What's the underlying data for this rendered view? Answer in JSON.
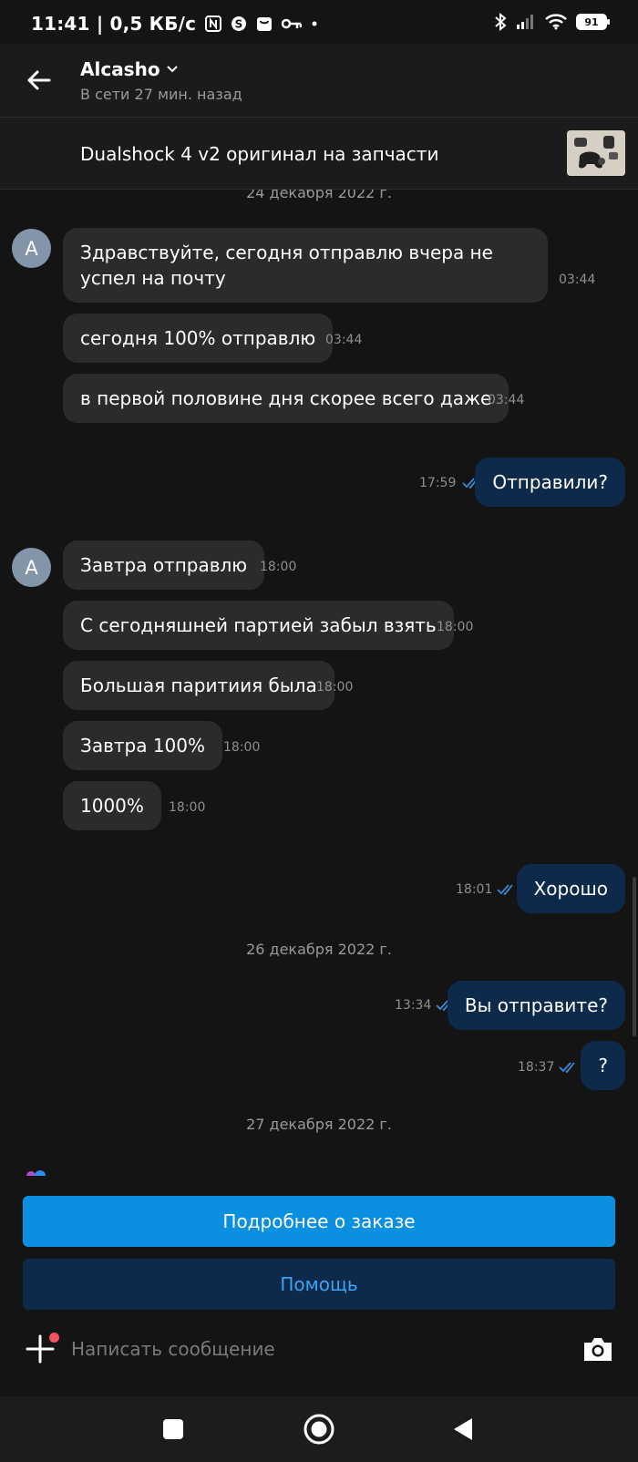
{
  "status_bar": {
    "text": "11:41 | 0,5 КБ/с",
    "battery": "91",
    "left_icons": [
      "nfc-icon",
      "skype-icon",
      "shopping-bag-icon",
      "key-icon",
      "dot-icon"
    ],
    "right_icons": [
      "bluetooth-icon",
      "signal-icon",
      "wifi-icon",
      "battery-icon"
    ]
  },
  "header": {
    "name": "Alcasho",
    "status": "В сети 27 мин. назад",
    "back_icon": "arrow-left-icon",
    "dropdown_icon": "chevron-down-icon"
  },
  "product": {
    "title": "Dualshock 4 v2 оригинал на запчасти",
    "thumbnail_icon": "product-thumbnail"
  },
  "messages": {
    "date1": "24 декабря 2022 г.",
    "date2": "26 декабря 2022 г.",
    "date3": "27 декабря 2022 г.",
    "avatar_letter": "A",
    "m1": {
      "text": "Здравствуйте, сегодня отправлю вчера не успел на почту",
      "time": "03:44"
    },
    "m2": {
      "text": "сегодня 100% отправлю",
      "time": "03:44"
    },
    "m3": {
      "text": "в первой половине дня скорее всего даже",
      "time": "03:44"
    },
    "m4": {
      "text": "Отправили?",
      "time": "17:59"
    },
    "m5": {
      "text": "Завтра отправлю",
      "time": "18:00"
    },
    "m6": {
      "text": "С сегодняшней партией забыл взять",
      "time": "18:00"
    },
    "m7": {
      "text": "Большая паритиия была",
      "time": "18:00"
    },
    "m8": {
      "text": "Завтра 100%",
      "time": "18:00"
    },
    "m9": {
      "text": "1000%",
      "time": "18:00"
    },
    "m10": {
      "text": "Хорошо",
      "time": "18:01"
    },
    "m11": {
      "text": "Вы отправите?",
      "time": "13:34"
    },
    "m12": {
      "text": "?",
      "time": "18:37"
    }
  },
  "actions": {
    "order_details": "Подробнее о заказе",
    "help": "Помощь"
  },
  "composer": {
    "placeholder": "Написать сообщение",
    "attach_icon": "plus-icon",
    "camera_icon": "camera-icon"
  },
  "nav": {
    "recents_icon": "square-icon",
    "home_icon": "circle-icon",
    "back_icon": "triangle-back-icon"
  },
  "colors": {
    "background": "#141414",
    "incoming_bubble": "#2b2b2b",
    "outgoing_bubble": "#0e2a4b",
    "primary_button": "#0b8fe0",
    "secondary_text": "#3aa3f2",
    "read_ticks": "#3a8ad8"
  }
}
